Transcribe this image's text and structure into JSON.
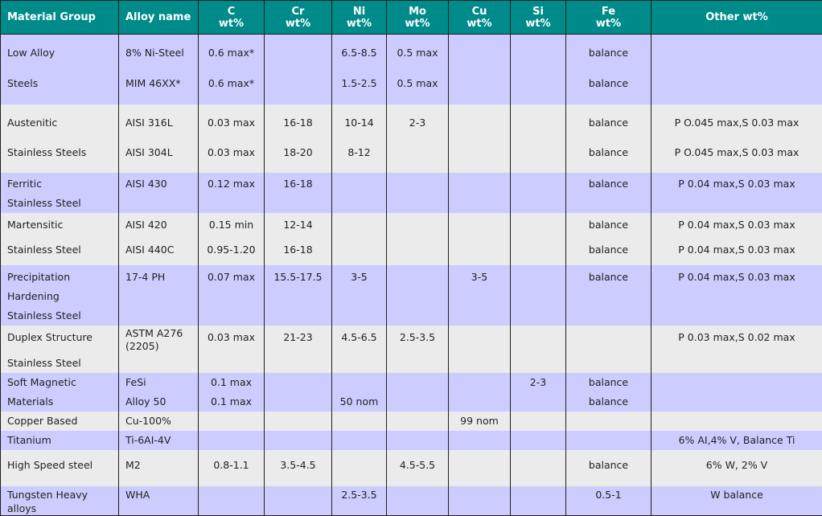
{
  "headers": [
    {
      "line1": "Material Group",
      "line2": ""
    },
    {
      "line1": "Alloy name",
      "line2": ""
    },
    {
      "line1": "C",
      "line2": "wt%"
    },
    {
      "line1": "Cr",
      "line2": "wt%"
    },
    {
      "line1": "Ni",
      "line2": "wt%"
    },
    {
      "line1": "Mo",
      "line2": "wt%"
    },
    {
      "line1": "Cu",
      "line2": "wt%"
    },
    {
      "line1": "Si",
      "line2": "wt%"
    },
    {
      "line1": "Fe",
      "line2": "wt%"
    },
    {
      "line1": "Other wt%",
      "line2": ""
    }
  ],
  "rows": [
    {
      "shade": "blue",
      "group": [
        "Low Alloy",
        "Steels"
      ],
      "alloy": [
        "8% Ni-Steel",
        "MIM 46XX*"
      ],
      "c": [
        "0.6 max*",
        "0.6 max*"
      ],
      "cr": [
        "",
        ""
      ],
      "ni": [
        "6.5-8.5",
        "1.5-2.5"
      ],
      "mo": [
        "0.5 max",
        "0.5 max"
      ],
      "cu": [
        "",
        ""
      ],
      "si": [
        "",
        ""
      ],
      "fe": [
        "balance",
        "balance"
      ],
      "other": [
        "",
        ""
      ]
    },
    {
      "shade": "grey",
      "group": [
        "Austenitic",
        "Stainless Steels"
      ],
      "alloy": [
        "AISI 316L",
        "AISI 304L"
      ],
      "c": [
        "0.03 max",
        "0.03 max"
      ],
      "cr": [
        "16-18",
        "18-20"
      ],
      "ni": [
        "10-14",
        "8-12"
      ],
      "mo": [
        "2-3",
        ""
      ],
      "cu": [
        "",
        ""
      ],
      "si": [
        "",
        ""
      ],
      "fe": [
        "balance",
        "balance"
      ],
      "other": [
        "P O.045 max,S 0.03 max",
        "P O.045 max,S 0.03 max"
      ]
    },
    {
      "shade": "blue",
      "group": [
        "Ferritic",
        "Stainless Steel"
      ],
      "alloy": [
        "AISI 430",
        ""
      ],
      "c": [
        "0.12 max",
        ""
      ],
      "cr": [
        "16-18",
        ""
      ],
      "ni": [
        "",
        ""
      ],
      "mo": [
        "",
        ""
      ],
      "cu": [
        "",
        ""
      ],
      "si": [
        "",
        ""
      ],
      "fe": [
        "balance",
        ""
      ],
      "other": [
        "P 0.04 max,S 0.03 max",
        ""
      ]
    },
    {
      "shade": "grey",
      "group": [
        "Martensitic",
        "Stainless Steel"
      ],
      "alloy": [
        "AISI 420",
        "AISI 440C"
      ],
      "c": [
        "0.15 min",
        "0.95-1.20"
      ],
      "cr": [
        "12-14",
        "16-18"
      ],
      "ni": [
        "",
        ""
      ],
      "mo": [
        "",
        ""
      ],
      "cu": [
        "",
        ""
      ],
      "si": [
        "",
        ""
      ],
      "fe": [
        "balance",
        "balance"
      ],
      "other": [
        "P 0.04 max,S 0.03 max",
        "P 0.04 max,S 0.03 max"
      ]
    },
    {
      "shade": "blue",
      "group": [
        "Precipitation",
        "Hardening",
        "Stainless Steel"
      ],
      "alloy": [
        "17-4 PH",
        "",
        ""
      ],
      "c": [
        "0.07 max",
        "",
        ""
      ],
      "cr": [
        "15.5-17.5",
        "",
        ""
      ],
      "ni": [
        "3-5",
        "",
        ""
      ],
      "mo": [
        "",
        "",
        ""
      ],
      "cu": [
        "3-5",
        "",
        ""
      ],
      "si": [
        "",
        "",
        ""
      ],
      "fe": [
        "balance",
        "",
        ""
      ],
      "other": [
        "P 0.04 max,S 0.03 max",
        "",
        ""
      ]
    },
    {
      "shade": "grey",
      "group": [
        "Duplex Structure",
        "Stainless Steel"
      ],
      "alloy": [
        "ASTM A276",
        "(2205)"
      ],
      "c": [
        "0.03 max",
        ""
      ],
      "cr": [
        "21-23",
        ""
      ],
      "ni": [
        "4.5-6.5",
        ""
      ],
      "mo": [
        "2.5-3.5",
        ""
      ],
      "cu": [
        "",
        ""
      ],
      "si": [
        "",
        ""
      ],
      "fe": [
        "",
        ""
      ],
      "other": [
        "P 0.03 max,S 0.02 max",
        ""
      ]
    },
    {
      "shade": "blue",
      "group": [
        "Soft Magnetic",
        "Materials"
      ],
      "alloy": [
        "FeSi",
        "Alloy 50"
      ],
      "c": [
        "0.1 max",
        "0.1 max"
      ],
      "cr": [
        "",
        ""
      ],
      "ni": [
        "",
        "50 nom"
      ],
      "mo": [
        "",
        ""
      ],
      "cu": [
        "",
        ""
      ],
      "si": [
        "2-3",
        ""
      ],
      "fe": [
        "balance",
        "balance"
      ],
      "other": [
        "",
        ""
      ]
    },
    {
      "shade": "grey",
      "group": [
        "Copper Based"
      ],
      "alloy": [
        "Cu-100%"
      ],
      "c": [
        ""
      ],
      "cr": [
        ""
      ],
      "ni": [
        ""
      ],
      "mo": [
        ""
      ],
      "cu": [
        "99 nom"
      ],
      "si": [
        ""
      ],
      "fe": [
        ""
      ],
      "other": [
        ""
      ]
    },
    {
      "shade": "blue",
      "group": [
        "Titanium"
      ],
      "alloy": [
        "Ti-6AI-4V"
      ],
      "c": [
        ""
      ],
      "cr": [
        ""
      ],
      "ni": [
        ""
      ],
      "mo": [
        ""
      ],
      "cu": [
        ""
      ],
      "si": [
        ""
      ],
      "fe": [
        ""
      ],
      "other": [
        "6% AI,4% V, Balance Ti"
      ]
    },
    {
      "shade": "grey",
      "group": [
        "High Speed steel"
      ],
      "alloy": [
        "M2"
      ],
      "c": [
        "0.8-1.1"
      ],
      "cr": [
        "3.5-4.5"
      ],
      "ni": [
        ""
      ],
      "mo": [
        "4.5-5.5"
      ],
      "cu": [
        ""
      ],
      "si": [
        ""
      ],
      "fe": [
        "balance"
      ],
      "other": [
        "6% W, 2% V"
      ]
    },
    {
      "shade": "blue",
      "group": [
        "Tungsten Heavy",
        "alloys"
      ],
      "alloy": [
        "WHA"
      ],
      "c": [
        ""
      ],
      "cr": [
        ""
      ],
      "ni": [
        "2.5-3.5"
      ],
      "mo": [
        ""
      ],
      "cu": [
        ""
      ],
      "si": [
        ""
      ],
      "fe": [
        "0.5-1"
      ],
      "other": [
        "W balance"
      ]
    }
  ]
}
